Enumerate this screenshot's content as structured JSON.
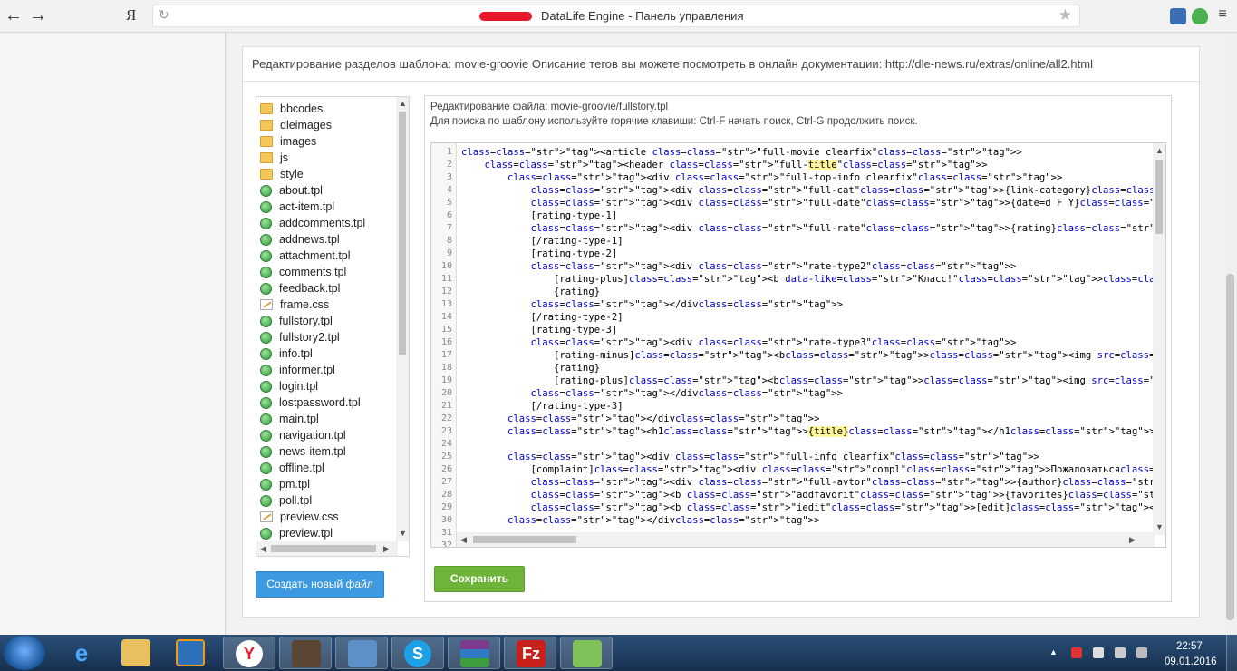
{
  "browser": {
    "title": "DataLife Engine - Панель управления",
    "logo": "Я",
    "back": "←",
    "forward": "→",
    "reload": "↻",
    "star": "★"
  },
  "panel": {
    "title": "Редактирование разделов шаблона: movie-groovie Описание тегов вы можете посмотреть в онлайн документации: http://dle-news.ru/extras/online/all2.html"
  },
  "tree": {
    "items": [
      {
        "name": "bbcodes",
        "type": "folder"
      },
      {
        "name": "dleimages",
        "type": "folder"
      },
      {
        "name": "images",
        "type": "folder"
      },
      {
        "name": "js",
        "type": "folder"
      },
      {
        "name": "style",
        "type": "folder"
      },
      {
        "name": "about.tpl",
        "type": "tpl"
      },
      {
        "name": "act-item.tpl",
        "type": "tpl"
      },
      {
        "name": "addcomments.tpl",
        "type": "tpl"
      },
      {
        "name": "addnews.tpl",
        "type": "tpl"
      },
      {
        "name": "attachment.tpl",
        "type": "tpl"
      },
      {
        "name": "comments.tpl",
        "type": "tpl"
      },
      {
        "name": "feedback.tpl",
        "type": "tpl"
      },
      {
        "name": "frame.css",
        "type": "css"
      },
      {
        "name": "fullstory.tpl",
        "type": "tpl"
      },
      {
        "name": "fullstory2.tpl",
        "type": "tpl"
      },
      {
        "name": "info.tpl",
        "type": "tpl"
      },
      {
        "name": "informer.tpl",
        "type": "tpl"
      },
      {
        "name": "login.tpl",
        "type": "tpl"
      },
      {
        "name": "lostpassword.tpl",
        "type": "tpl"
      },
      {
        "name": "main.tpl",
        "type": "tpl"
      },
      {
        "name": "navigation.tpl",
        "type": "tpl"
      },
      {
        "name": "news-item.tpl",
        "type": "tpl"
      },
      {
        "name": "offline.tpl",
        "type": "tpl"
      },
      {
        "name": "pm.tpl",
        "type": "tpl"
      },
      {
        "name": "poll.tpl",
        "type": "tpl"
      },
      {
        "name": "preview.css",
        "type": "css"
      },
      {
        "name": "preview.tpl",
        "type": "tpl"
      }
    ]
  },
  "buttons": {
    "new_file": "Создать новый файл",
    "save": "Сохранить"
  },
  "editor": {
    "file_label": "Редактирование файла: movie-groovie/fullstory.tpl",
    "hint": "Для поиска по шаблону используйте горячие клавиши: Ctrl-F начать поиск, Ctrl-G продолжить поиск.",
    "lines": [
      "<article class=\"full-movie clearfix\">",
      "    <header class=\"full-title\">",
      "        <div class=\"full-top-info clearfix\">",
      "            <div class=\"full-cat\">{link-category}</div>",
      "            <div class=\"full-date\">{date=d F Y}</div>",
      "            [rating-type-1]",
      "            <div class=\"full-rate\">{rating}</div>",
      "            [/rating-type-1]",
      "            [rating-type-2]",
      "            <div class=\"rate-type2\">",
      "                [rating-plus]<b data-like=\"Класс!\"><img src=\"{THEME}/images/like.png\" title=\"Нравится\" alt=\"Нравит",
      "                {rating}",
      "            </div>",
      "            [/rating-type-2]",
      "            [rating-type-3]",
      "            <div class=\"rate-type3\">",
      "                [rating-minus]<b><img src=\"{THEME}/images/unlike.png\" title=\"Не нравится\" alt=\"Не нравится\"></b>[/",
      "                {rating}",
      "                [rating-plus]<b><img src=\"{THEME}/images/like.png\" title=\"Нравится\" alt=\"Нравится\"></b>[/rating-pl",
      "            </div>",
      "            [/rating-type-3]",
      "        </div>",
      "        <h1>{title}</h1>",
      "",
      "        <div class=\"full-info clearfix\">",
      "            [complaint]<div class=\"compl\">Пожаловаться</div>[/complaint]",
      "            <div class=\"full-avtor\">{author}</div>",
      "            <b class=\"addfavorit\">{favorites}</b>",
      "            <b class=\"iedit\">[edit]<img src=\"{THEME}/dleimages/editstore.png\" />[/edit]</b>",
      "        </div>",
      "",
      ""
    ]
  },
  "taskbar": {
    "time": "22:57",
    "date": "09.01.2016"
  },
  "colors": {
    "save_button": "#6eb43a",
    "new_file_button": "#3d9ae0",
    "taskbar": "#1e3d60"
  }
}
